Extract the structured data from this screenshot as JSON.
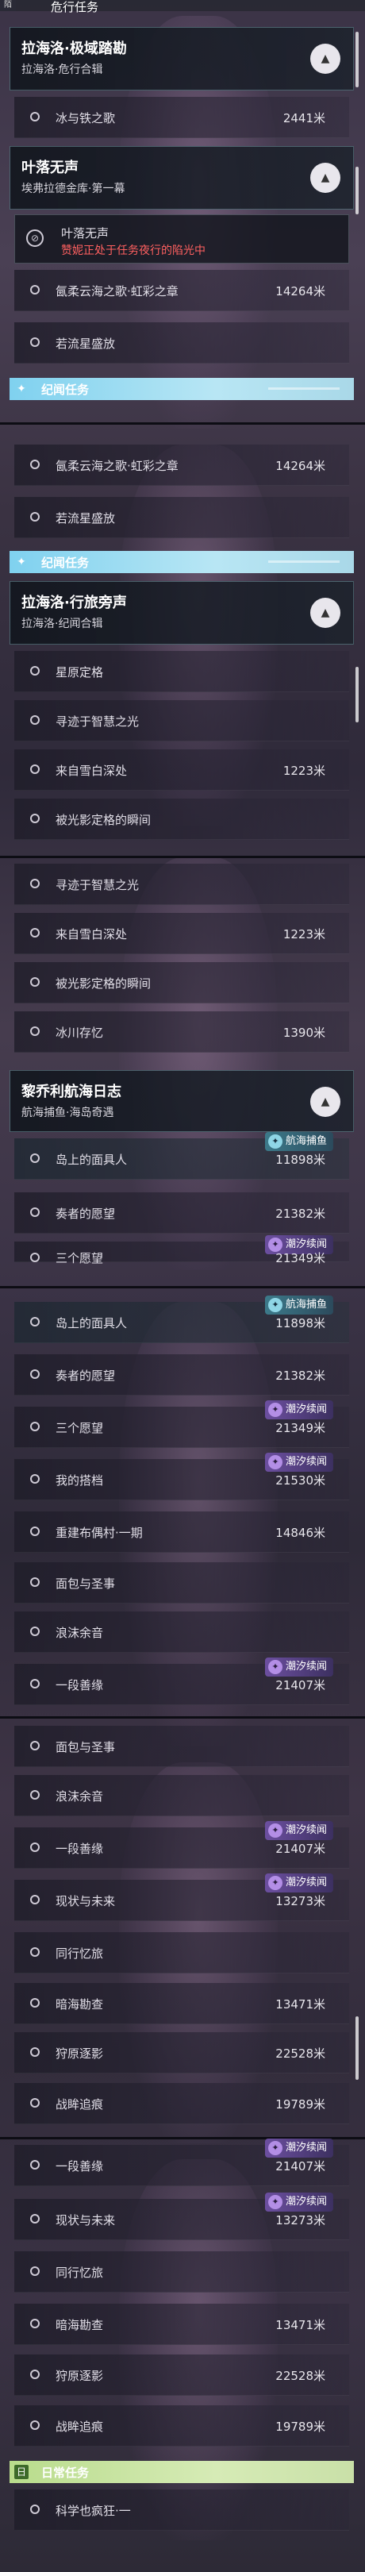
{
  "top": {
    "icon": "陌",
    "title": "危行任务"
  },
  "cards": {
    "c1": {
      "title": "拉海洛·极域踏勘",
      "sub": "拉海洛·危行合辑"
    },
    "c2": {
      "title": "叶落无声",
      "sub": "埃弗拉德金库·第一幕"
    },
    "c3": {
      "title": "拉海洛·行旅旁声",
      "sub": "拉海洛·纪闻合辑"
    },
    "c4": {
      "title": "黎乔利航海日志",
      "sub": "航海捕鱼·海岛奇遇"
    }
  },
  "warn": {
    "line1": "叶落无声",
    "line2": "赞妮正处于任务夜行的陷光中"
  },
  "sections": {
    "jiwen": "纪闻任务",
    "daily": "日常任务",
    "daily_icon": "日"
  },
  "tags": {
    "hanghai": "航海捕鱼",
    "chaoxi": "潮汐续闻"
  },
  "labels": {
    "bingyu": "冰与铁之歌",
    "piaorou": "氤柔云海之歌·虹彩之章",
    "ruoliu": "若流星盛放",
    "xingyuan": "星原定格",
    "xunji": "寻迹于智慧之光",
    "laizi": "来自雪白深处",
    "beiguang": "被光影定格的瞬间",
    "bingchuan": "冰川存忆",
    "daoshang": "岛上的面具人",
    "zouzhe": "奏者的愿望",
    "sange": "三个愿望",
    "dada": "我的搭档",
    "chongjian": "重建布偶村·一期",
    "mianbao": "面包与圣事",
    "langmo": "浪沫余音",
    "yiduan": "一段善缘",
    "xianzhuang": "现状与未来",
    "tongxing": "同行忆旅",
    "anhai": "暗海勘查",
    "shoulie": "狩原逐影",
    "zhanhen": "战眸追痕",
    "kexue": "科学也疯狂·一"
  },
  "dists": {
    "d2441": "2441米",
    "d14264": "14264米",
    "d1223": "1223米",
    "d1390": "1390米",
    "d11898": "11898米",
    "d21382": "21382米",
    "d21349": "21349米",
    "d21530": "21530米",
    "d14846": "14846米",
    "d21407": "21407米",
    "d13273": "13273米",
    "d13471": "13471米",
    "d22528": "22528米",
    "d19789": "19789米"
  }
}
